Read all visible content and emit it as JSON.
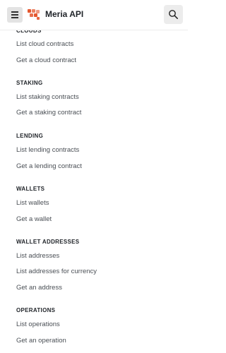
{
  "header": {
    "title": "Meria API",
    "menu_icon": "menu-icon",
    "search_icon": "search-icon",
    "logo_color": "#e4572e"
  },
  "nav": {
    "sections": [
      {
        "title": "CLOUDS",
        "items": [
          "List cloud contracts",
          "Get a cloud contract"
        ]
      },
      {
        "title": "STAKING",
        "items": [
          "List staking contracts",
          "Get a staking contract"
        ]
      },
      {
        "title": "LENDING",
        "items": [
          "List lending contracts",
          "Get a lending contract"
        ]
      },
      {
        "title": "WALLETS",
        "items": [
          "List wallets",
          "Get a wallet"
        ]
      },
      {
        "title": "WALLET ADDRESSES",
        "items": [
          "List addresses",
          "List addresses for currency",
          "Get an address"
        ]
      },
      {
        "title": "OPERATIONS",
        "items": [
          "List operations",
          "Get an operation"
        ]
      }
    ]
  }
}
